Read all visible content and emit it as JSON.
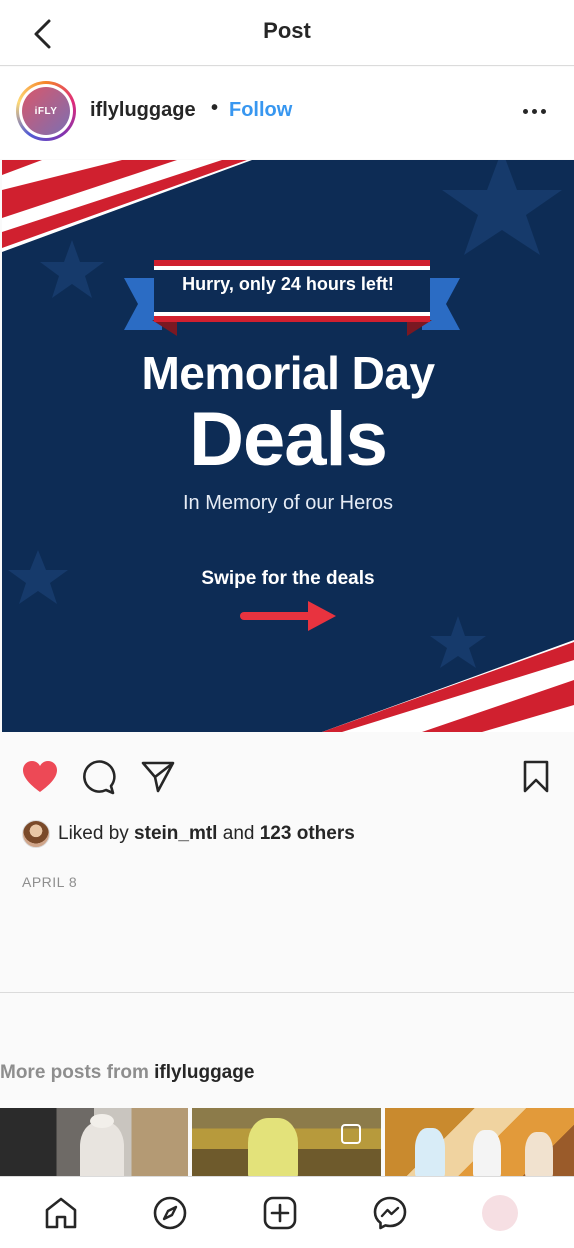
{
  "topbar": {
    "title": "Post",
    "back_icon": "chevron-left-icon"
  },
  "post": {
    "avatar_text": "iFLY",
    "username": "iflyluggage",
    "separator": "•",
    "follow_label": "Follow",
    "more_icon": "ellipsis-icon",
    "image": {
      "ribbon_text": "Hurry, only 24 hours left!",
      "headline_line1": "Memorial Day",
      "headline_line2": "Deals",
      "subline": "In Memory of our Heros",
      "cta": "Swipe for the deals",
      "colors": {
        "navy": "#0d2c55",
        "red": "#d0202f",
        "white": "#ffffff",
        "arrow": "#e8333f"
      }
    },
    "actions": {
      "like_icon": "heart-filled-icon",
      "comment_icon": "comment-icon",
      "share_icon": "send-icon",
      "save_icon": "bookmark-icon",
      "like_color": "#ed4956"
    },
    "likes": {
      "prefix": "Liked by ",
      "user": "stein_mtl",
      "middle": " and ",
      "others": "123 others"
    },
    "date": "APRIL 8"
  },
  "more_posts": {
    "prefix": "More posts from ",
    "username": "iflyluggage"
  },
  "tabbar": {
    "items": [
      "home-icon",
      "explore-icon",
      "new-post-icon",
      "messenger-icon",
      "profile-avatar"
    ]
  }
}
